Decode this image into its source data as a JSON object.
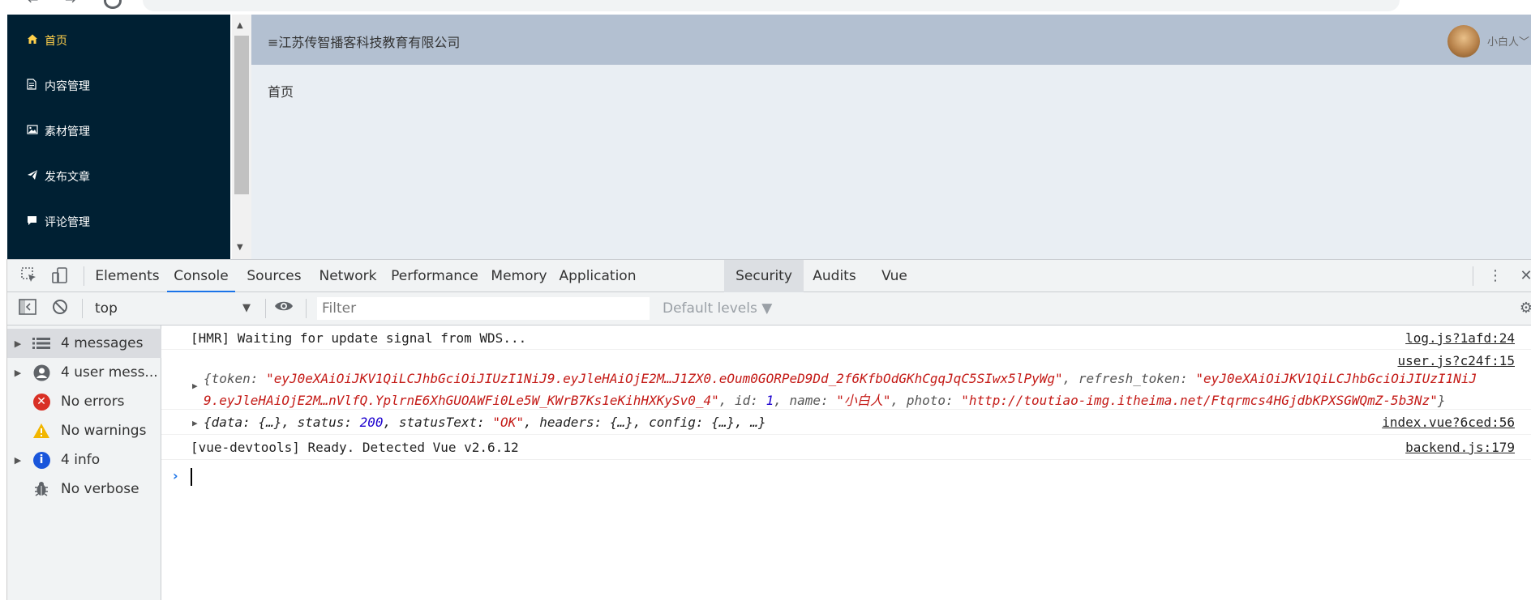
{
  "app": {
    "sidebar": {
      "items": [
        {
          "label": "首页",
          "icon": "home-icon",
          "active": true
        },
        {
          "label": "内容管理",
          "icon": "document-icon"
        },
        {
          "label": "素材管理",
          "icon": "image-icon"
        },
        {
          "label": "发布文章",
          "icon": "send-icon"
        },
        {
          "label": "评论管理",
          "icon": "comment-icon"
        }
      ]
    },
    "header": {
      "company": "≡江苏传智播客科技教育有限公司",
      "user_name": "小白人"
    },
    "main": {
      "text": "首页"
    }
  },
  "devtools": {
    "tabs": [
      {
        "label": "Elements"
      },
      {
        "label": "Console",
        "active": true
      },
      {
        "label": "Sources"
      },
      {
        "label": "Network"
      },
      {
        "label": "Performance"
      },
      {
        "label": "Memory"
      },
      {
        "label": "Application"
      },
      {
        "label": "Security"
      },
      {
        "label": "Audits"
      },
      {
        "label": "Vue"
      }
    ],
    "toolbar": {
      "context": "top",
      "filter_placeholder": "Filter",
      "levels": "Default levels ▼"
    },
    "side_panel": [
      {
        "label": "4 messages",
        "icon": "list-icon",
        "expandable": true
      },
      {
        "label": "4 user mess...",
        "icon": "user-icon",
        "expandable": true
      },
      {
        "label": "No errors",
        "icon": "error-icon",
        "expandable": false
      },
      {
        "label": "No warnings",
        "icon": "warning-icon",
        "expandable": false
      },
      {
        "label": "4 info",
        "icon": "info-icon",
        "expandable": true
      },
      {
        "label": "No verbose",
        "icon": "bug-icon",
        "expandable": false
      }
    ],
    "messages": [
      {
        "text": "[HMR] Waiting for update signal from WDS...",
        "source": "log.js?1afd:24"
      },
      {
        "source": "user.js?c24f:15",
        "line1": {
          "k_token": "{token: ",
          "v_token": "\"eyJ0eXAiOiJKV1QiLCJhbGciOiJIUzI1NiJ9.eyJleHAiOjE2M…J1ZX0.eOum0GORPeD9Dd_2f6KfbOdGKhCgqJqC5SIwx5lPyWg\"",
          "k_refresh": ", refresh_token: ",
          "v_refresh1": "\"eyJ0eXAiOiJKV1QiLCJhbGciOiJIUzI1NiJ"
        },
        "line2": {
          "v_refresh2": "9.eyJleHAiOjE2M…nVlfQ.YplrnE6XhGUOAWFi0Le5W_KWrB7Ks1eKihHXKySv0_4\"",
          "k_id": ", id: ",
          "v_id": "1",
          "k_name": ", name: ",
          "v_name": "\"小白人\"",
          "k_photo": ", photo: ",
          "v_photo": "\"http://toutiao-img.itheima.net/Ftqrmcs4HGjdbKPXSGWQmZ-5b3Nz\"",
          "close": "}"
        }
      },
      {
        "source": "index.vue?6ced:56",
        "parts": {
          "a": "{data: {…}, status: ",
          "status": "200",
          "b": ", statusText: ",
          "statusText": "\"OK\"",
          "c": ", headers: {…}, config: {…}, …}"
        }
      },
      {
        "text": "[vue-devtools] Ready. Detected Vue v2.6.12",
        "source": "backend.js:179"
      }
    ]
  },
  "colors": {
    "sidebar_bg": "#002033",
    "sidebar_active": "#ffd04b",
    "header_bg": "#b3c0d1",
    "main_bg": "#e9eef3",
    "devtools_bg": "#f1f3f4",
    "accent": "#1a73e8",
    "string": "#c41a16",
    "number": "#1c00cf"
  }
}
